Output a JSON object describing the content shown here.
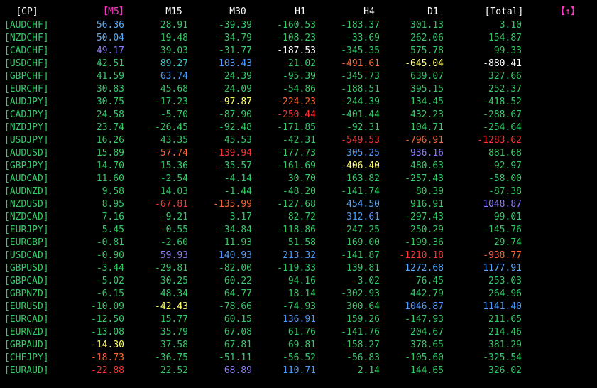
{
  "colors": {
    "background": "#000000",
    "pair": "#33cc66",
    "header": "#ffffff",
    "header_sort": "#ff33cc",
    "green": "#33cc66",
    "white": "#ffffff",
    "yellow": "#ffff66",
    "red": "#ff3333",
    "blue": "#4a9cff",
    "purple": "#8a7cff",
    "orange": "#ff6633",
    "light_blue": "#55aaff",
    "cyan": "#33cccc"
  },
  "headers": [
    "[CP]",
    "【M5】",
    "M15",
    "M30",
    "H1",
    "H4",
    "D1",
    "[Total]",
    "【↑】"
  ],
  "header_colors": [
    "header",
    "header_sort",
    "header",
    "header",
    "header",
    "header",
    "header",
    "header",
    "header_sort"
  ],
  "rows": [
    {
      "pair": "[AUDCHF]",
      "values": [
        "56.36",
        "28.91",
        "-39.39",
        "-160.53",
        "-183.37",
        "301.13",
        "3.10"
      ],
      "colors": [
        "light_blue",
        "green",
        "green",
        "green",
        "green",
        "green",
        "green"
      ]
    },
    {
      "pair": "[NZDCHF]",
      "values": [
        "50.04",
        "19.48",
        "-34.79",
        "-108.23",
        "-33.69",
        "262.06",
        "154.87"
      ],
      "colors": [
        "light_blue",
        "green",
        "green",
        "green",
        "green",
        "green",
        "green"
      ]
    },
    {
      "pair": "[CADCHF]",
      "values": [
        "49.17",
        "39.03",
        "-31.77",
        "-187.53",
        "-345.35",
        "575.78",
        "99.33"
      ],
      "colors": [
        "purple",
        "green",
        "green",
        "white",
        "green",
        "green",
        "green"
      ]
    },
    {
      "pair": "[USDCHF]",
      "values": [
        "42.51",
        "89.27",
        "103.43",
        "21.02",
        "-491.61",
        "-645.04",
        "-880.41"
      ],
      "colors": [
        "green",
        "cyan",
        "blue",
        "green",
        "orange",
        "yellow",
        "white"
      ]
    },
    {
      "pair": "[GBPCHF]",
      "values": [
        "41.59",
        "63.74",
        "24.39",
        "-95.39",
        "-345.73",
        "639.07",
        "327.66"
      ],
      "colors": [
        "green",
        "blue",
        "green",
        "green",
        "green",
        "green",
        "green"
      ]
    },
    {
      "pair": "[EURCHF]",
      "values": [
        "30.83",
        "45.68",
        "24.09",
        "-54.86",
        "-188.51",
        "395.15",
        "252.37"
      ],
      "colors": [
        "green",
        "green",
        "green",
        "green",
        "green",
        "green",
        "green"
      ]
    },
    {
      "pair": "[AUDJPY]",
      "values": [
        "30.75",
        "-17.23",
        "-97.87",
        "-224.23",
        "-244.39",
        "134.45",
        "-418.52"
      ],
      "colors": [
        "green",
        "green",
        "yellow",
        "orange",
        "green",
        "green",
        "green"
      ]
    },
    {
      "pair": "[CADJPY]",
      "values": [
        "24.58",
        "-5.70",
        "-87.90",
        "-250.44",
        "-401.44",
        "432.23",
        "-288.67"
      ],
      "colors": [
        "green",
        "green",
        "green",
        "red",
        "green",
        "green",
        "green"
      ]
    },
    {
      "pair": "[NZDJPY]",
      "values": [
        "23.74",
        "-26.45",
        "-92.48",
        "-171.85",
        "-92.31",
        "104.71",
        "-254.64"
      ],
      "colors": [
        "green",
        "green",
        "green",
        "green",
        "green",
        "green",
        "green"
      ]
    },
    {
      "pair": "[USDJPY]",
      "values": [
        "16.26",
        "43.35",
        "45.53",
        "-42.31",
        "-549.53",
        "-796.91",
        "-1283.62"
      ],
      "colors": [
        "green",
        "green",
        "green",
        "green",
        "red",
        "orange",
        "red"
      ]
    },
    {
      "pair": "[AUDUSD]",
      "values": [
        "15.89",
        "-57.74",
        "-139.94",
        "-177.73",
        "305.25",
        "936.16",
        "881.68"
      ],
      "colors": [
        "green",
        "orange",
        "red",
        "green",
        "blue",
        "purple",
        "green"
      ]
    },
    {
      "pair": "[GBPJPY]",
      "values": [
        "14.70",
        "15.36",
        "-35.57",
        "-161.69",
        "-406.40",
        "480.63",
        "-92.97"
      ],
      "colors": [
        "green",
        "green",
        "green",
        "green",
        "yellow",
        "green",
        "green"
      ]
    },
    {
      "pair": "[AUDCAD]",
      "values": [
        "11.60",
        "-2.54",
        "-4.14",
        "30.70",
        "163.82",
        "-257.43",
        "-58.00"
      ],
      "colors": [
        "green",
        "green",
        "green",
        "green",
        "green",
        "green",
        "green"
      ]
    },
    {
      "pair": "[AUDNZD]",
      "values": [
        "9.58",
        "14.03",
        "-1.44",
        "-48.20",
        "-141.74",
        "80.39",
        "-87.38"
      ],
      "colors": [
        "green",
        "green",
        "green",
        "green",
        "green",
        "green",
        "green"
      ]
    },
    {
      "pair": "[NZDUSD]",
      "values": [
        "8.95",
        "-67.81",
        "-135.99",
        "-127.68",
        "454.50",
        "916.91",
        "1048.87"
      ],
      "colors": [
        "green",
        "red",
        "orange",
        "green",
        "light_blue",
        "green",
        "purple"
      ]
    },
    {
      "pair": "[NZDCAD]",
      "values": [
        "7.16",
        "-9.21",
        "3.17",
        "82.72",
        "312.61",
        "-297.43",
        "99.01"
      ],
      "colors": [
        "green",
        "green",
        "green",
        "green",
        "blue",
        "green",
        "green"
      ]
    },
    {
      "pair": "[EURJPY]",
      "values": [
        "5.45",
        "-0.55",
        "-34.84",
        "-118.86",
        "-247.25",
        "250.29",
        "-145.76"
      ],
      "colors": [
        "green",
        "green",
        "green",
        "green",
        "green",
        "green",
        "green"
      ]
    },
    {
      "pair": "[EURGBP]",
      "values": [
        "-0.81",
        "-2.60",
        "11.93",
        "51.58",
        "169.00",
        "-199.36",
        "29.74"
      ],
      "colors": [
        "green",
        "green",
        "green",
        "green",
        "green",
        "green",
        "green"
      ]
    },
    {
      "pair": "[USDCAD]",
      "values": [
        "-0.90",
        "59.93",
        "140.93",
        "213.32",
        "-141.87",
        "-1210.18",
        "-938.77"
      ],
      "colors": [
        "green",
        "purple",
        "blue",
        "blue",
        "green",
        "red",
        "orange"
      ]
    },
    {
      "pair": "[GBPUSD]",
      "values": [
        "-3.44",
        "-29.81",
        "-82.00",
        "-119.33",
        "139.81",
        "1272.68",
        "1177.91"
      ],
      "colors": [
        "green",
        "green",
        "green",
        "green",
        "green",
        "light_blue",
        "light_blue"
      ]
    },
    {
      "pair": "[GBPCAD]",
      "values": [
        "-5.02",
        "30.25",
        "60.22",
        "94.16",
        "-3.02",
        "76.45",
        "253.03"
      ],
      "colors": [
        "green",
        "green",
        "green",
        "green",
        "green",
        "green",
        "green"
      ]
    },
    {
      "pair": "[GBPNZD]",
      "values": [
        "-6.15",
        "48.34",
        "64.77",
        "18.14",
        "-302.93",
        "442.79",
        "264.96"
      ],
      "colors": [
        "green",
        "green",
        "green",
        "green",
        "green",
        "green",
        "green"
      ]
    },
    {
      "pair": "[EURUSD]",
      "values": [
        "-10.09",
        "-42.43",
        "-78.66",
        "-74.93",
        "300.64",
        "1046.87",
        "1141.40"
      ],
      "colors": [
        "green",
        "yellow",
        "green",
        "green",
        "green",
        "blue",
        "blue"
      ]
    },
    {
      "pair": "[EURCAD]",
      "values": [
        "-12.50",
        "15.77",
        "60.15",
        "136.91",
        "159.26",
        "-147.93",
        "211.65"
      ],
      "colors": [
        "green",
        "green",
        "green",
        "blue",
        "green",
        "green",
        "green"
      ]
    },
    {
      "pair": "[EURNZD]",
      "values": [
        "-13.08",
        "35.79",
        "67.08",
        "61.76",
        "-141.76",
        "204.67",
        "214.46"
      ],
      "colors": [
        "green",
        "green",
        "green",
        "green",
        "green",
        "green",
        "green"
      ]
    },
    {
      "pair": "[GBPAUD]",
      "values": [
        "-14.30",
        "37.58",
        "67.81",
        "69.81",
        "-158.27",
        "378.65",
        "381.29"
      ],
      "colors": [
        "yellow",
        "green",
        "green",
        "green",
        "green",
        "green",
        "green"
      ]
    },
    {
      "pair": "[CHFJPY]",
      "values": [
        "-18.73",
        "-36.75",
        "-51.11",
        "-56.52",
        "-56.83",
        "-105.60",
        "-325.54"
      ],
      "colors": [
        "orange",
        "green",
        "green",
        "green",
        "green",
        "green",
        "green"
      ]
    },
    {
      "pair": "[EURAUD]",
      "values": [
        "-22.88",
        "22.52",
        "68.89",
        "110.71",
        "2.14",
        "144.65",
        "326.02"
      ],
      "colors": [
        "red",
        "green",
        "purple",
        "blue",
        "green",
        "green",
        "green"
      ]
    }
  ]
}
